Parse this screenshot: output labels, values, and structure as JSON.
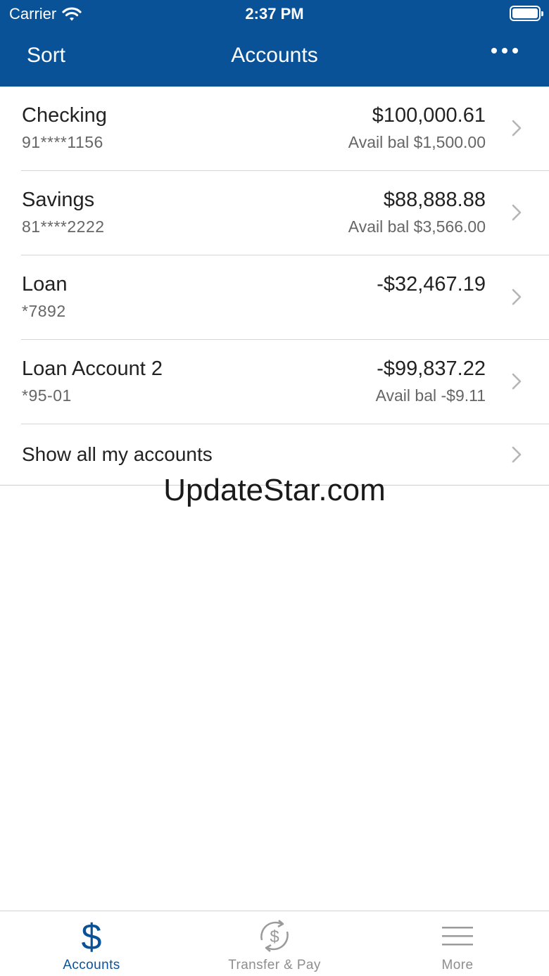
{
  "status_bar": {
    "carrier": "Carrier",
    "time": "2:37 PM"
  },
  "nav": {
    "left_label": "Sort",
    "title": "Accounts",
    "menu_icon": "more-dots-icon"
  },
  "accounts": [
    {
      "name": "Checking",
      "number": "91****1156",
      "balance": "$100,000.61",
      "available": "Avail bal $1,500.00"
    },
    {
      "name": "Savings",
      "number": "81****2222",
      "balance": "$88,888.88",
      "available": "Avail bal $3,566.00"
    },
    {
      "name": "Loan",
      "number": "*7892",
      "balance": "-$32,467.19",
      "available": ""
    },
    {
      "name": "Loan Account 2",
      "number": "*95-01",
      "balance": "-$99,837.22",
      "available": "Avail bal -$9.11"
    }
  ],
  "show_all": "Show all my accounts",
  "watermark": "UpdateStar.com",
  "tabs": [
    {
      "label": "Accounts",
      "icon": "dollar-icon",
      "active": true
    },
    {
      "label": "Transfer & Pay",
      "icon": "transfer-dollar-icon",
      "active": false
    },
    {
      "label": "More",
      "icon": "hamburger-menu-icon",
      "active": false
    }
  ],
  "colors": {
    "brand": "#0a5298",
    "tab_inactive": "#8e8e8e",
    "chevron": "#b5b5b5"
  }
}
